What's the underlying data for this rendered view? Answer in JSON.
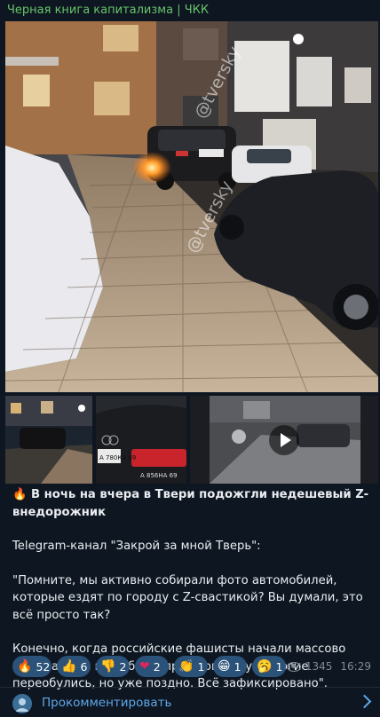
{
  "channel": {
    "name": "Черная книга капитализма | ЧКК"
  },
  "media": {
    "watermark_1": "@tversky",
    "watermark_2": "@tversky",
    "plate_1": "А 780КА 69",
    "plate_2": "А 856НА 69",
    "play_icon": "play-icon"
  },
  "post": {
    "headline_emoji": "🔥",
    "headline": "В ночь на вчера в Твери подожгли недешевый Z-внедорожник",
    "source": "Telegram-канал \"Закрой за мной Тверь\":",
    "quote": "\"Помните, мы активно собирали фото автомобилей, которые ездят по городу с Z-свастикой? Вы думали, это всё просто так?",
    "body": "Конечно, когда российские фашисты начали массово подыхать на поле боя в прошлом году - многие переобулись, но уже поздно. Всё зафиксировано\"."
  },
  "reactions": [
    {
      "emoji": "🔥",
      "count": "52"
    },
    {
      "emoji": "👍",
      "count": "6"
    },
    {
      "emoji": "👎",
      "count": "2"
    },
    {
      "emoji": "❤",
      "count": "2"
    },
    {
      "emoji": "👏",
      "count": "1"
    },
    {
      "emoji": "😁",
      "count": "1"
    },
    {
      "emoji": "🥱",
      "count": "1"
    }
  ],
  "meta": {
    "views": "1345",
    "time": "16:29"
  },
  "comments": {
    "label": "Прокомментировать"
  },
  "colors": {
    "background": "#0e1621",
    "channel_name": "#67c46c",
    "link": "#5fa8e8",
    "chip": "#2b5278"
  }
}
